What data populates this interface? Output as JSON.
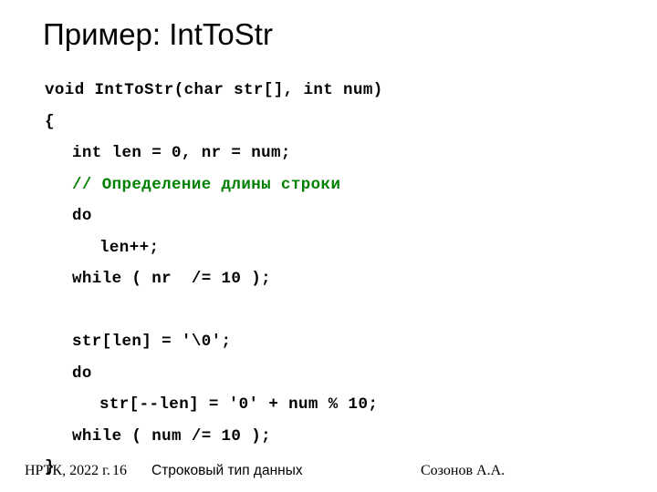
{
  "slide": {
    "title": "Пример: IntToStr",
    "background_color": "#ffffff",
    "text_color": "#000000",
    "comment_color": "#008000"
  },
  "code": {
    "language": "c",
    "lines": [
      {
        "indent": 0,
        "text": "void IntToStr(char str[], int num)",
        "kind": "code"
      },
      {
        "indent": 0,
        "text": "{",
        "kind": "code"
      },
      {
        "indent": 1,
        "text": "int len = 0, nr = num;",
        "kind": "code"
      },
      {
        "indent": 1,
        "text": "// Определение длины строки",
        "kind": "comment"
      },
      {
        "indent": 1,
        "text": "do",
        "kind": "code"
      },
      {
        "indent": 2,
        "text": "len++;",
        "kind": "code"
      },
      {
        "indent": 1,
        "text": "while ( nr  /= 10 );",
        "kind": "code"
      },
      {
        "indent": 1,
        "text": "",
        "kind": "blank"
      },
      {
        "indent": 1,
        "text": "str[len] = '\\0';",
        "kind": "code"
      },
      {
        "indent": 1,
        "text": "do",
        "kind": "code"
      },
      {
        "indent": 2,
        "text": "str[--len] = '0' + num % 10;",
        "kind": "code"
      },
      {
        "indent": 1,
        "text": "while ( num /= 10 );",
        "kind": "code"
      },
      {
        "indent": 0,
        "text": "}",
        "kind": "code"
      }
    ]
  },
  "footer": {
    "organization": "НРТК, 2022 г.",
    "page_number": "16",
    "section": "Строковый тип данных",
    "author": "Созонов А.А."
  }
}
